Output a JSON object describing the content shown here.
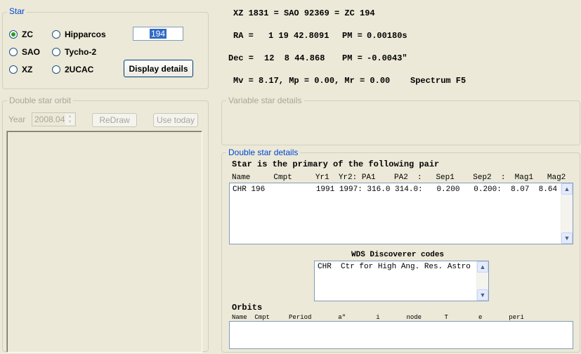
{
  "star_group": {
    "title": "Star",
    "radios": [
      {
        "label": "ZC",
        "checked": true
      },
      {
        "label": "SAO",
        "checked": false
      },
      {
        "label": "XZ",
        "checked": false
      },
      {
        "label": "Hipparcos",
        "checked": false
      },
      {
        "label": "Tycho-2",
        "checked": false
      },
      {
        "label": "2UCAC",
        "checked": false
      }
    ],
    "star_number": "194",
    "display_details_label": "Display details"
  },
  "star_info": {
    "line1": "XZ 1831 = SAO 92369 = ZC 194",
    "ra_label": "RA =",
    "ra_value": "1 19 42.8091",
    "pm_ra_label": "PM =",
    "pm_ra_value": "0.00180s",
    "dec_label": "Dec =",
    "dec_value": "12  8 44.868",
    "pm_dec_label": "PM =",
    "pm_dec_value": "-0.0043\"",
    "mags": "Mv = 8.17, Mp = 0.00, Mr = 0.00",
    "spectrum": "Spectrum F5"
  },
  "orbit_group": {
    "title": "Double star orbit",
    "year_label": "Year",
    "year_value": "2008.04",
    "redraw_label": "ReDraw",
    "use_today_label": "Use today"
  },
  "variable_group": {
    "title": "Variable star details"
  },
  "double_group": {
    "title": "Double star details",
    "heading": "Star is the primary of the following pair",
    "columns": "Name     Cmpt     Yr1  Yr2: PA1    PA2  :   Sep1    Sep2  :  Mag1   Mag2",
    "row": "CHR 196           1991 1997: 316.0 314.0:   0.200   0.200:  8.07  8.64",
    "wds_heading": "WDS Discoverer codes",
    "wds_entry": "CHR  Ctr for High Ang. Res. Astro",
    "orbits_heading": "Orbits",
    "orbits_columns": "Name  Cmpt     Period       a\"        i       node      T        e       peri"
  },
  "colors": {
    "background": "#ece9d8",
    "group_title": "#0046d5",
    "disabled_text": "#a7a69a",
    "radio_dot": "#21a121",
    "selection": "#316ac5"
  }
}
